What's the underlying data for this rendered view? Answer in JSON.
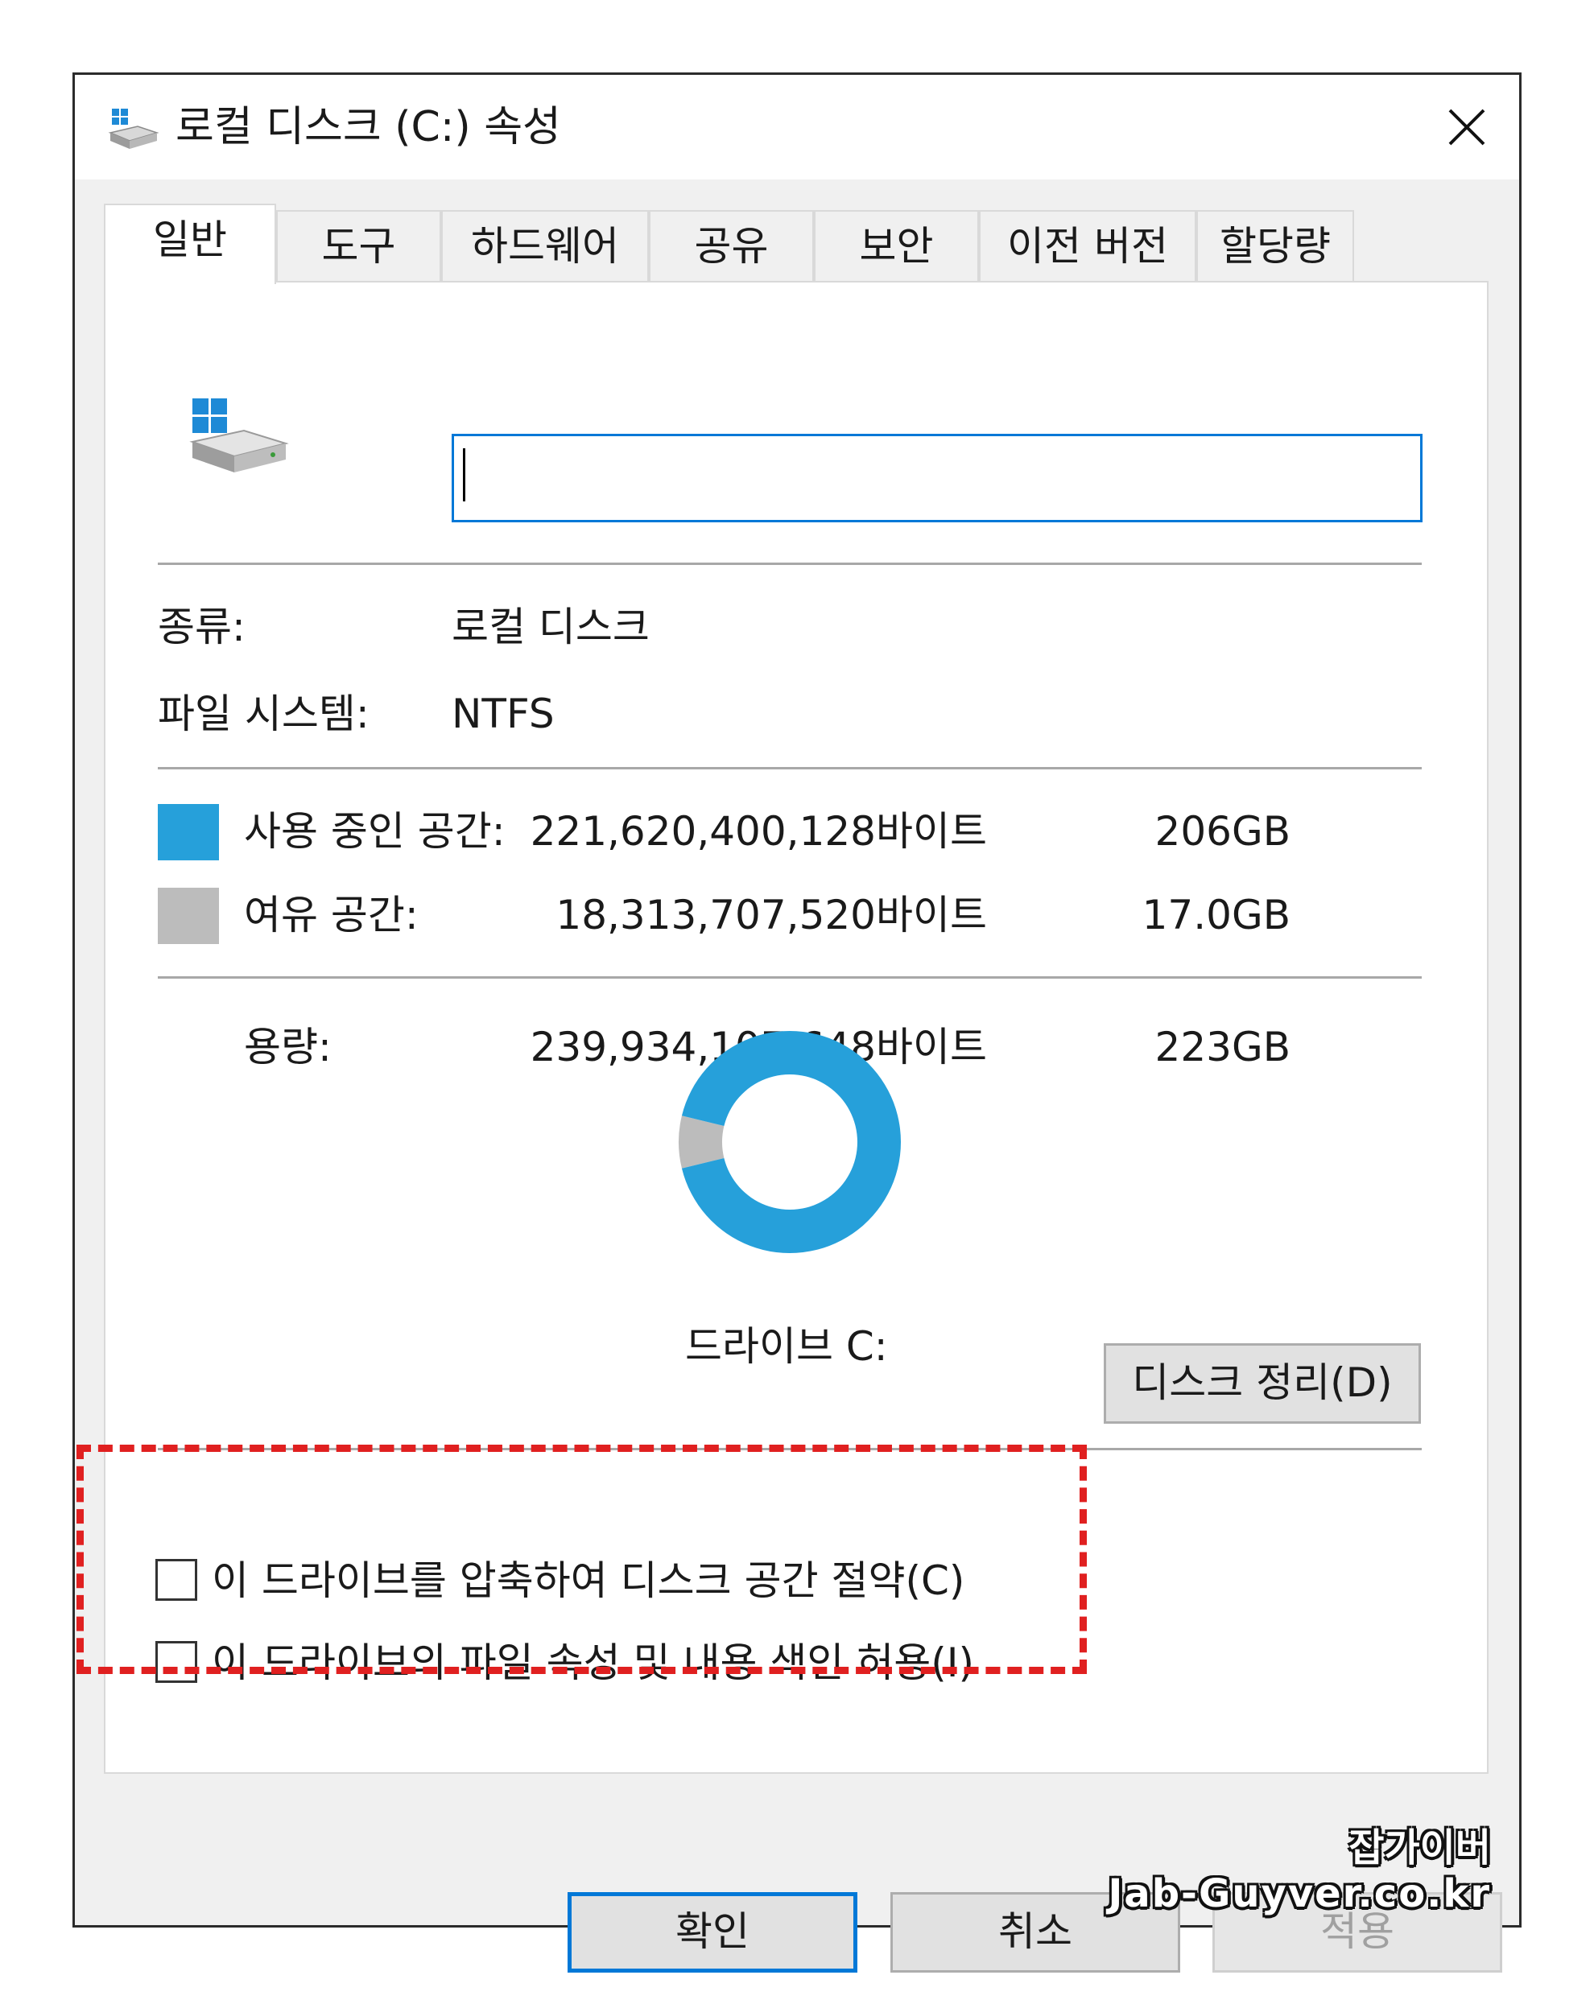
{
  "window": {
    "title": "로컬 디스크 (C:) 속성",
    "close_icon": "close-icon"
  },
  "tabs": [
    {
      "label": "일반",
      "active": true
    },
    {
      "label": "도구",
      "active": false
    },
    {
      "label": "하드웨어",
      "active": false
    },
    {
      "label": "공유",
      "active": false
    },
    {
      "label": "보안",
      "active": false
    },
    {
      "label": "이전 버전",
      "active": false
    },
    {
      "label": "할당량",
      "active": false
    }
  ],
  "general": {
    "drive_icon": "drive-icon",
    "name_input": {
      "value": "",
      "placeholder": ""
    },
    "type_label": "종류:",
    "type_value": "로컬 디스크",
    "fs_label": "파일 시스템:",
    "fs_value": "NTFS",
    "used": {
      "label": "사용 중인 공간:",
      "bytes": "221,620,400,128바이트",
      "size": "206GB",
      "color": "#26a0da"
    },
    "free": {
      "label": "여유 공간:",
      "bytes": "18,313,707,520바이트",
      "size": "17.0GB",
      "color": "#bcbcbc"
    },
    "capacity": {
      "label": "용량:",
      "bytes": "239,934,107,648바이트",
      "size": "223GB"
    },
    "drive_label": "드라이브 C:",
    "cleanup_button": "디스크 정리(D)",
    "compress_checkbox": {
      "label": "이 드라이브를 압축하여 디스크 공간 절약(C)",
      "checked": false
    },
    "index_checkbox": {
      "label": "이 드라이브의 파일 속성 및 내용 색인 허용(I)",
      "checked": false
    }
  },
  "buttons": {
    "ok": "확인",
    "cancel": "취소",
    "apply": "적용"
  },
  "watermark": {
    "line1": "잡가이버",
    "line2": "Jab-Guyver.co.kr"
  },
  "chart_data": {
    "type": "pie",
    "title": "",
    "categories": [
      "사용 중인 공간",
      "여유 공간"
    ],
    "values": [
      221620400128,
      18313707520
    ],
    "colors": [
      "#26a0da",
      "#bcbcbc"
    ]
  }
}
